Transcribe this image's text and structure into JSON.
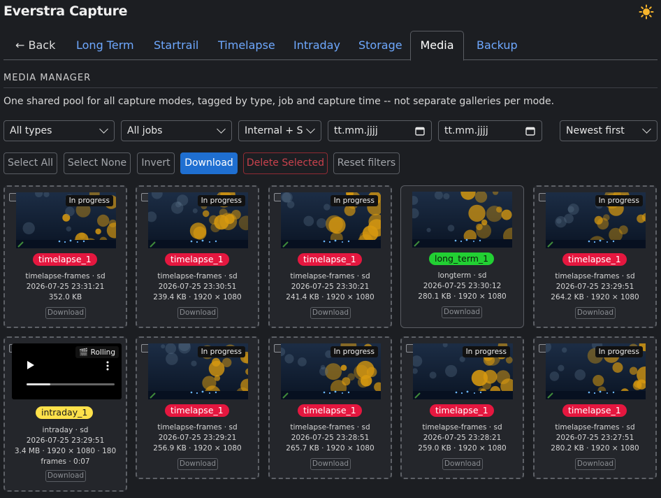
{
  "app": {
    "title": "Everstra Capture",
    "theme_icon": "sun-icon"
  },
  "nav": {
    "back_label": "← Back",
    "tabs": [
      "Long Term",
      "Startrail",
      "Timelapse",
      "Intraday",
      "Storage",
      "Media",
      "Backup"
    ],
    "active": "Media"
  },
  "section": {
    "title": "MEDIA MANAGER",
    "description": "One shared pool for all capture modes, tagged by type, job and capture time -- not separate galleries per mode."
  },
  "filters": {
    "type": "All types",
    "job": "All jobs",
    "storage": "Internal + S",
    "date_from_placeholder": "tt.mm.jjjj",
    "date_to_placeholder": "tt.mm.jjjj",
    "sort": "Newest first"
  },
  "actions": {
    "select_all": "Select All",
    "select_none": "Select None",
    "invert": "Invert",
    "download": "Download",
    "delete_selected": "Delete Selected",
    "reset_filters": "Reset filters"
  },
  "colors": {
    "accent": "#1f6fd1",
    "link": "#6ea8fe",
    "tag_timelapse": "#e5173f",
    "tag_longterm": "#22d033",
    "tag_intraday": "#ffe14a"
  },
  "cards": [
    {
      "badge": "In progress",
      "tag": "timelapse_1",
      "tag_color": "red",
      "type_line": "timelapse-frames · sd",
      "time": "2026-07-25 23:31:21",
      "size": "352.0 KB",
      "download": "Download"
    },
    {
      "badge": "In progress",
      "tag": "timelapse_1",
      "tag_color": "red",
      "type_line": "timelapse-frames · sd",
      "time": "2026-07-25 23:30:51",
      "size": "239.4 KB · 1920 × 1080",
      "download": "Download"
    },
    {
      "badge": "In progress",
      "tag": "timelapse_1",
      "tag_color": "red",
      "type_line": "timelapse-frames · sd",
      "time": "2026-07-25 23:30:21",
      "size": "241.4 KB · 1920 × 1080",
      "download": "Download"
    },
    {
      "badge": "",
      "tag": "long_term_1",
      "tag_color": "green",
      "type_line": "longterm · sd",
      "time": "2026-07-25 23:30:12",
      "size": "280.1 KB · 1920 × 1080",
      "download": "Download"
    },
    {
      "badge": "In progress",
      "tag": "timelapse_1",
      "tag_color": "red",
      "type_line": "timelapse-frames · sd",
      "time": "2026-07-25 23:29:51",
      "size": "264.2 KB · 1920 × 1080",
      "download": "Download"
    },
    {
      "badge": "🎬 Rolling",
      "tag": "intraday_1",
      "tag_color": "yellow",
      "type_line": "intraday · sd",
      "time": "2026-07-25 23:29:51",
      "size": "3.4 MB · 1920 × 1080 · 180",
      "size2": "frames · 0:07",
      "download": "Download",
      "video": true,
      "video_progress": 0.27
    },
    {
      "badge": "In progress",
      "tag": "timelapse_1",
      "tag_color": "red",
      "type_line": "timelapse-frames · sd",
      "time": "2026-07-25 23:29:21",
      "size": "256.9 KB · 1920 × 1080",
      "download": "Download"
    },
    {
      "badge": "In progress",
      "tag": "timelapse_1",
      "tag_color": "red",
      "type_line": "timelapse-frames · sd",
      "time": "2026-07-25 23:28:51",
      "size": "265.7 KB · 1920 × 1080",
      "download": "Download"
    },
    {
      "badge": "In progress",
      "tag": "timelapse_1",
      "tag_color": "red",
      "type_line": "timelapse-frames · sd",
      "time": "2026-07-25 23:28:21",
      "size": "259.0 KB · 1920 × 1080",
      "download": "Download"
    },
    {
      "badge": "In progress",
      "tag": "timelapse_1",
      "tag_color": "red",
      "type_line": "timelapse-frames · sd",
      "time": "2026-07-25 23:27:51",
      "size": "280.2 KB · 1920 × 1080",
      "download": "Download"
    }
  ]
}
